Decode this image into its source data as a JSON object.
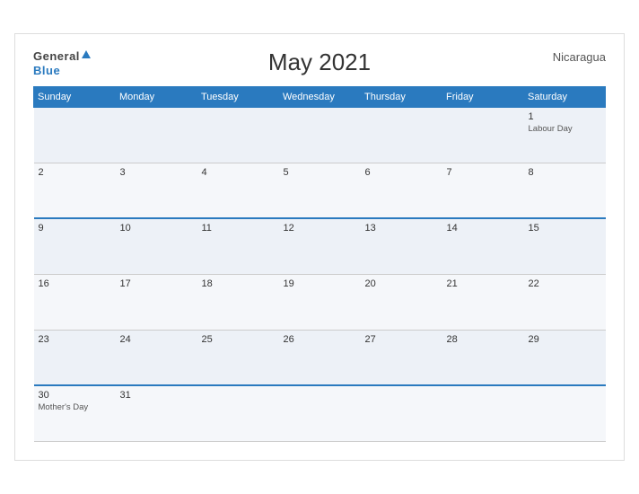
{
  "header": {
    "logo_general": "General",
    "logo_blue": "Blue",
    "title": "May 2021",
    "country": "Nicaragua"
  },
  "weekdays": [
    "Sunday",
    "Monday",
    "Tuesday",
    "Wednesday",
    "Thursday",
    "Friday",
    "Saturday"
  ],
  "weeks": [
    {
      "blue_top": false,
      "days": [
        {
          "number": "",
          "holiday": "",
          "empty": true
        },
        {
          "number": "",
          "holiday": "",
          "empty": true
        },
        {
          "number": "",
          "holiday": "",
          "empty": true
        },
        {
          "number": "",
          "holiday": "",
          "empty": true
        },
        {
          "number": "",
          "holiday": "",
          "empty": true
        },
        {
          "number": "",
          "holiday": "",
          "empty": true
        },
        {
          "number": "1",
          "holiday": "Labour Day",
          "empty": false
        }
      ]
    },
    {
      "blue_top": false,
      "days": [
        {
          "number": "2",
          "holiday": "",
          "empty": false
        },
        {
          "number": "3",
          "holiday": "",
          "empty": false
        },
        {
          "number": "4",
          "holiday": "",
          "empty": false
        },
        {
          "number": "5",
          "holiday": "",
          "empty": false
        },
        {
          "number": "6",
          "holiday": "",
          "empty": false
        },
        {
          "number": "7",
          "holiday": "",
          "empty": false
        },
        {
          "number": "8",
          "holiday": "",
          "empty": false
        }
      ]
    },
    {
      "blue_top": true,
      "days": [
        {
          "number": "9",
          "holiday": "",
          "empty": false
        },
        {
          "number": "10",
          "holiday": "",
          "empty": false
        },
        {
          "number": "11",
          "holiday": "",
          "empty": false
        },
        {
          "number": "12",
          "holiday": "",
          "empty": false
        },
        {
          "number": "13",
          "holiday": "",
          "empty": false
        },
        {
          "number": "14",
          "holiday": "",
          "empty": false
        },
        {
          "number": "15",
          "holiday": "",
          "empty": false
        }
      ]
    },
    {
      "blue_top": false,
      "days": [
        {
          "number": "16",
          "holiday": "",
          "empty": false
        },
        {
          "number": "17",
          "holiday": "",
          "empty": false
        },
        {
          "number": "18",
          "holiday": "",
          "empty": false
        },
        {
          "number": "19",
          "holiday": "",
          "empty": false
        },
        {
          "number": "20",
          "holiday": "",
          "empty": false
        },
        {
          "number": "21",
          "holiday": "",
          "empty": false
        },
        {
          "number": "22",
          "holiday": "",
          "empty": false
        }
      ]
    },
    {
      "blue_top": false,
      "days": [
        {
          "number": "23",
          "holiday": "",
          "empty": false
        },
        {
          "number": "24",
          "holiday": "",
          "empty": false
        },
        {
          "number": "25",
          "holiday": "",
          "empty": false
        },
        {
          "number": "26",
          "holiday": "",
          "empty": false
        },
        {
          "number": "27",
          "holiday": "",
          "empty": false
        },
        {
          "number": "28",
          "holiday": "",
          "empty": false
        },
        {
          "number": "29",
          "holiday": "",
          "empty": false
        }
      ]
    },
    {
      "blue_top": true,
      "days": [
        {
          "number": "30",
          "holiday": "Mother's Day",
          "empty": false
        },
        {
          "number": "31",
          "holiday": "",
          "empty": false
        },
        {
          "number": "",
          "holiday": "",
          "empty": true
        },
        {
          "number": "",
          "holiday": "",
          "empty": true
        },
        {
          "number": "",
          "holiday": "",
          "empty": true
        },
        {
          "number": "",
          "holiday": "",
          "empty": true
        },
        {
          "number": "",
          "holiday": "",
          "empty": true
        }
      ]
    }
  ]
}
